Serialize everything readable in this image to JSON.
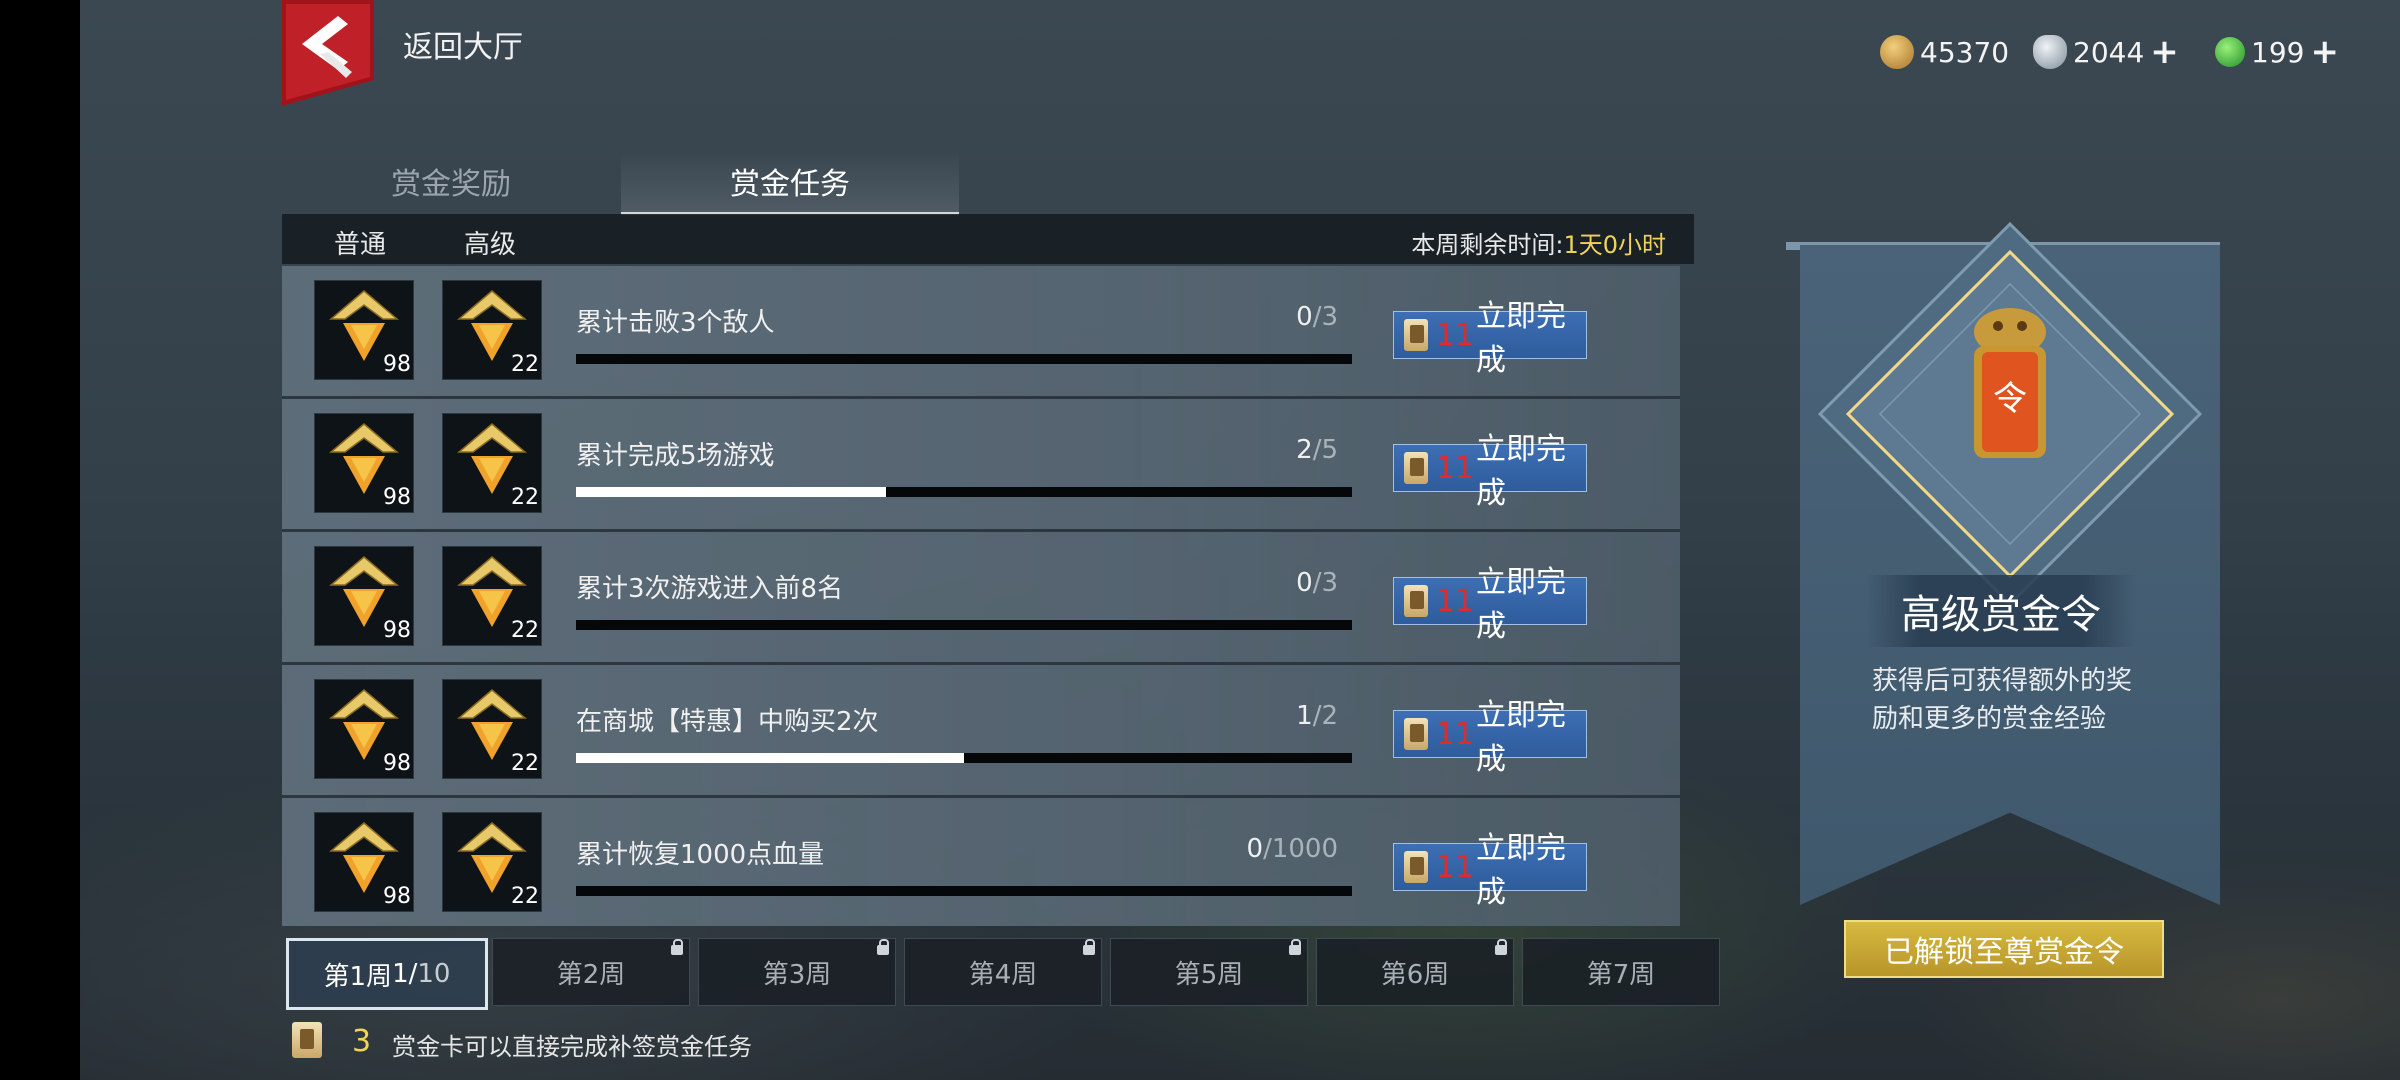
{
  "top_bar": {
    "back_label": "返回大厅",
    "currencies": [
      {
        "name": "copper-coin",
        "value": "45370",
        "has_plus": false,
        "color": "#b8863a"
      },
      {
        "name": "silver-ingot",
        "value": "2044",
        "has_plus": true,
        "color": "#b9c3cc"
      },
      {
        "name": "jade-coin",
        "value": "199",
        "has_plus": true,
        "color": "#3cc23c"
      }
    ]
  },
  "tabs": [
    {
      "label": "赏金奖励",
      "active": false
    },
    {
      "label": "赏金任务",
      "active": true
    }
  ],
  "header": {
    "col_normal": "普通",
    "col_advanced": "高级",
    "remaining_prefix": "本周剩余时间:",
    "remaining_value": "1天0小时"
  },
  "tasks": [
    {
      "title": "累计击败3个敌人",
      "done": "0",
      "total": "/3",
      "fraction": 0,
      "reward_normal": "98",
      "reward_advanced": "22",
      "cost": "11",
      "button": "立即完成"
    },
    {
      "title": "累计完成5场游戏",
      "done": "2",
      "total": "/5",
      "fraction": 0.4,
      "reward_normal": "98",
      "reward_advanced": "22",
      "cost": "11",
      "button": "立即完成"
    },
    {
      "title": "累计3次游戏进入前8名",
      "done": "0",
      "total": "/3",
      "fraction": 0,
      "reward_normal": "98",
      "reward_advanced": "22",
      "cost": "11",
      "button": "立即完成"
    },
    {
      "title": "在商城【特惠】中购买2次",
      "done": "1",
      "total": "/2",
      "fraction": 0.5,
      "reward_normal": "98",
      "reward_advanced": "22",
      "cost": "11",
      "button": "立即完成"
    },
    {
      "title": "累计恢复1000点血量",
      "done": "0",
      "total": "/1000",
      "fraction": 0,
      "reward_normal": "98",
      "reward_advanced": "22",
      "cost": "11",
      "button": "立即完成"
    }
  ],
  "weeks": [
    {
      "label": "第1周",
      "sub": "1/",
      "sub2": "10",
      "active": true,
      "locked": false
    },
    {
      "label": "第2周",
      "active": false,
      "locked": true
    },
    {
      "label": "第3周",
      "active": false,
      "locked": true
    },
    {
      "label": "第4周",
      "active": false,
      "locked": true
    },
    {
      "label": "第5周",
      "active": false,
      "locked": true
    },
    {
      "label": "第6周",
      "active": false,
      "locked": true
    },
    {
      "label": "第7周",
      "active": false,
      "locked": false
    }
  ],
  "footer": {
    "card_count": "3",
    "text": "赏金卡可以直接完成补签赏金任务"
  },
  "premium": {
    "title": "高级赏金令",
    "description": "获得后可获得额外的奖励和更多的赏金经验",
    "button": "已解锁至尊赏金令",
    "token_char": "令"
  }
}
